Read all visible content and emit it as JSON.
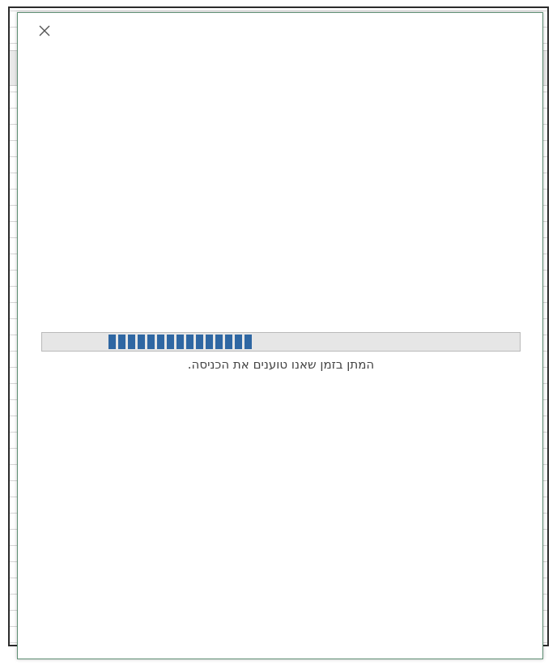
{
  "dialog": {
    "close_icon": "close-icon",
    "status_message": "המתן בזמן שאנו טוענים את הכניסה.",
    "progress": {
      "indeterminate": true,
      "visible_block_count": 15,
      "fill_color": "#2f67a3",
      "track_color": "#e6e6e6"
    }
  },
  "colors": {
    "dialog_border": "#5e8e73",
    "text": "#444444"
  }
}
